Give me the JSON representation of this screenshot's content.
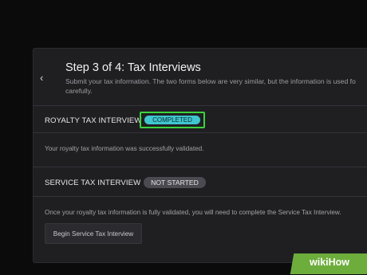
{
  "header": {
    "back_icon": "chevron-left-icon",
    "title": "Step 3 of 4: Tax Interviews",
    "description_line1": "Submit your tax information. The two forms below are very similar, but the information is used fo",
    "description_line2": "carefully."
  },
  "royalty": {
    "title": "ROYALTY TAX INTERVIEW",
    "status": "COMPLETED",
    "status_color": "#3fc6cf",
    "highlight_color": "#3cd43c",
    "message": "Your royalty tax information was successfully validated."
  },
  "service": {
    "title": "SERVICE TAX INTERVIEW",
    "status": "NOT STARTED",
    "message": "Once your royalty tax information is fully validated, you will need to complete the Service Tax Interview.",
    "button_label": "Begin Service Tax Interview"
  },
  "watermark": {
    "text": "wikiHow",
    "color": "#6dad3c"
  }
}
